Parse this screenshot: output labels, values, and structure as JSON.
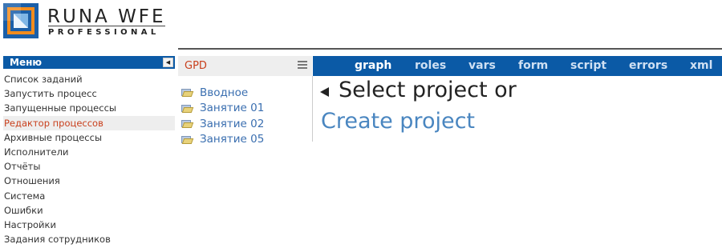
{
  "brand": {
    "title": "RUNA WFE",
    "subtitle": "PROFESSIONAL",
    "colors": {
      "mark_blue": "#1b5fa8",
      "mark_orange": "#f28c1e",
      "mark_light": "#7fb6e6"
    }
  },
  "menu": {
    "header": "Меню",
    "collapse_icon": "triangle-left",
    "items": [
      {
        "label": "Список заданий"
      },
      {
        "label": "Запустить процесс"
      },
      {
        "label": "Запущенные процессы"
      },
      {
        "label": "Редактор процессов",
        "active": true
      },
      {
        "label": "Архивные процессы"
      },
      {
        "label": "Исполнители"
      },
      {
        "label": "Отчёты"
      },
      {
        "label": "Отношения"
      },
      {
        "label": "Система"
      },
      {
        "label": "Ошибки"
      },
      {
        "label": "Настройки"
      },
      {
        "label": "Задания сотрудников"
      }
    ]
  },
  "projects": {
    "title": "GPD",
    "menu_icon": "hamburger",
    "items": [
      {
        "label": "Вводное",
        "icon": "folder-open"
      },
      {
        "label": "Занятие 01",
        "icon": "folder-open"
      },
      {
        "label": "Занятие 02",
        "icon": "folder-open"
      },
      {
        "label": "Занятие 05",
        "icon": "folder-open"
      }
    ]
  },
  "editor": {
    "tabs": [
      "graph",
      "roles",
      "vars",
      "form",
      "script",
      "errors",
      "xml"
    ],
    "active_tab": "graph",
    "select_text": "Select project or",
    "create_link": "Create project"
  },
  "theme": {
    "accent": "#0b5aa6",
    "active_text": "#c9401d",
    "link": "#4a86c0"
  }
}
